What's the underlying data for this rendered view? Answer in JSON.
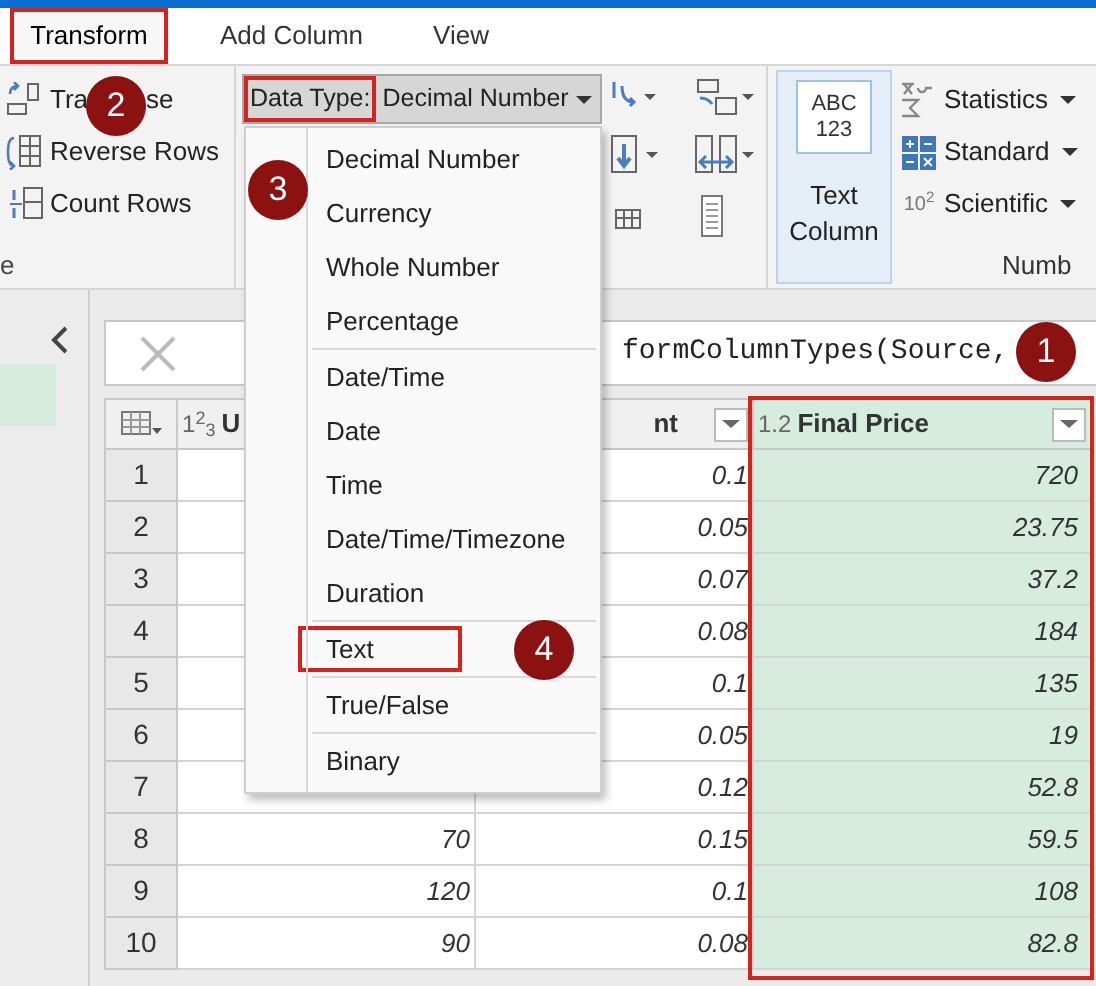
{
  "tabs": [
    {
      "label": "Transform",
      "selected": true,
      "annotated": true
    },
    {
      "label": "Add Column",
      "selected": false,
      "annotated": false
    },
    {
      "label": "View",
      "selected": false,
      "annotated": false
    }
  ],
  "table_group": {
    "label": "e",
    "items": [
      {
        "label": "Tra",
        "label_end": "se"
      },
      {
        "label": "Reverse Rows"
      },
      {
        "label": "Count Rows"
      }
    ]
  },
  "data_type": {
    "label": "Data Type:",
    "value": "Decimal Number",
    "annotated": true,
    "expanded": true
  },
  "data_type_menu": {
    "groups": [
      [
        {
          "label": "Decimal Number",
          "annotated": false
        },
        {
          "label": "Currency",
          "annotated": false
        },
        {
          "label": "Whole Number",
          "annotated": false
        },
        {
          "label": "Percentage",
          "annotated": false
        }
      ],
      [
        {
          "label": "Date/Time",
          "annotated": false
        },
        {
          "label": "Date",
          "annotated": false
        },
        {
          "label": "Time",
          "annotated": false
        },
        {
          "label": "Date/Time/Timezone",
          "annotated": false
        },
        {
          "label": "Duration",
          "annotated": false
        }
      ],
      [
        {
          "label": "Text",
          "annotated": true
        }
      ],
      [
        {
          "label": "True/False",
          "annotated": false
        }
      ],
      [
        {
          "label": "Binary",
          "annotated": false
        }
      ]
    ]
  },
  "text_column": {
    "icon_lines": [
      "ABC",
      "123"
    ],
    "label": "Text Column"
  },
  "number_group": {
    "label": "Numb",
    "items": [
      {
        "label": "Statistics"
      },
      {
        "label": "Standard"
      },
      {
        "label": "Scientific",
        "icon_text": "10$^{2}$"
      }
    ]
  },
  "formula_bar": {
    "text": "formColumnTypes(Source, "
  },
  "table": {
    "columns": [
      {
        "type": "1$^{2}$$_{3}$",
        "name": "U",
        "filter": false,
        "annotated": false
      },
      {
        "name": "nt",
        "filter": true,
        "annotated": false
      },
      {
        "type": "1.2",
        "name": "Final Price",
        "filter": true,
        "annotated": true
      }
    ],
    "rows": [
      {
        "index": "1",
        "col_3": "0.1",
        "col_4": "720"
      },
      {
        "index": "2",
        "col_3": "0.05",
        "col_4": "23.75"
      },
      {
        "index": "3",
        "col_3": "0.07",
        "col_4": "37.2"
      },
      {
        "index": "4",
        "col_3": "0.08",
        "col_4": "184"
      },
      {
        "index": "5",
        "col_3": "0.1",
        "col_4": "135"
      },
      {
        "index": "6",
        "col_3": "0.05",
        "col_4": "19"
      },
      {
        "index": "7",
        "col_3": "0.12",
        "col_4": "52.8"
      },
      {
        "index": "8",
        "col_2": "70",
        "col_3": "0.15",
        "col_4": "59.5"
      },
      {
        "index": "9",
        "col_2": "120",
        "col_3": "0.1",
        "col_4": "108"
      },
      {
        "index": "10",
        "col_2": "90",
        "col_3": "0.08",
        "col_4": "82.8"
      }
    ]
  },
  "callouts": [
    {
      "number": "1"
    },
    {
      "number": "2"
    },
    {
      "number": "3"
    },
    {
      "number": "4"
    }
  ]
}
